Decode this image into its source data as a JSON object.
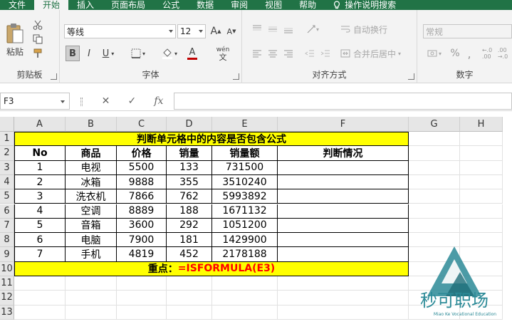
{
  "tabs": [
    "文件",
    "开始",
    "插入",
    "页面布局",
    "公式",
    "数据",
    "审阅",
    "视图",
    "帮助"
  ],
  "active_tab": "开始",
  "tell_me": "操作说明搜索",
  "clipboard": {
    "paste_label": "粘贴",
    "group_label": "剪贴板"
  },
  "font": {
    "family": "等线",
    "size": "12",
    "group_label": "字体",
    "bold": "B",
    "italic": "I",
    "underline": "U",
    "wen": "wén",
    "grow": "A",
    "shrink": "A",
    "color_a": "A"
  },
  "alignment": {
    "wrap": "自动换行",
    "merge": "合并后居中",
    "group_label": "对齐方式"
  },
  "number": {
    "format": "常规",
    "percent": "%",
    "group_label": "数字"
  },
  "formula_bar": {
    "name_box": "F3",
    "cancel": "✕",
    "enter": "✓",
    "fx": "fx",
    "content": ""
  },
  "colors": {
    "ribbon_green": "#217346",
    "highlight_yellow": "#ffff00",
    "formula_red": "#ff0000",
    "watermark_teal": "#2b8a97"
  },
  "columns": [
    "A",
    "B",
    "C",
    "D",
    "E",
    "F",
    "G",
    "H"
  ],
  "rows": [
    "1",
    "2",
    "3",
    "4",
    "5",
    "6",
    "7",
    "8",
    "9",
    "10",
    "11",
    "12",
    "13"
  ],
  "sheet": {
    "title": "判断单元格中的内容是否包含公式",
    "headers": [
      "No",
      "商品",
      "价格",
      "销量",
      "销量额",
      "判断情况"
    ],
    "data": [
      [
        "1",
        "电视",
        "5500",
        "133",
        "731500",
        ""
      ],
      [
        "2",
        "冰箱",
        "9888",
        "355",
        "3510240",
        ""
      ],
      [
        "3",
        "洗衣机",
        "7866",
        "762",
        "5993892",
        ""
      ],
      [
        "4",
        "空调",
        "8889",
        "188",
        "1671132",
        ""
      ],
      [
        "5",
        "音箱",
        "3600",
        "292",
        "1051200",
        ""
      ],
      [
        "6",
        "电脑",
        "7900",
        "181",
        "1429900",
        ""
      ],
      [
        "7",
        "手机",
        "4819",
        "452",
        "2178188",
        ""
      ]
    ],
    "key_label": "重点：",
    "key_formula": "=ISFORMULA(E3)"
  },
  "watermark": {
    "name": "秒可职场",
    "subtitle": "Miao Ke Vocational Education"
  }
}
